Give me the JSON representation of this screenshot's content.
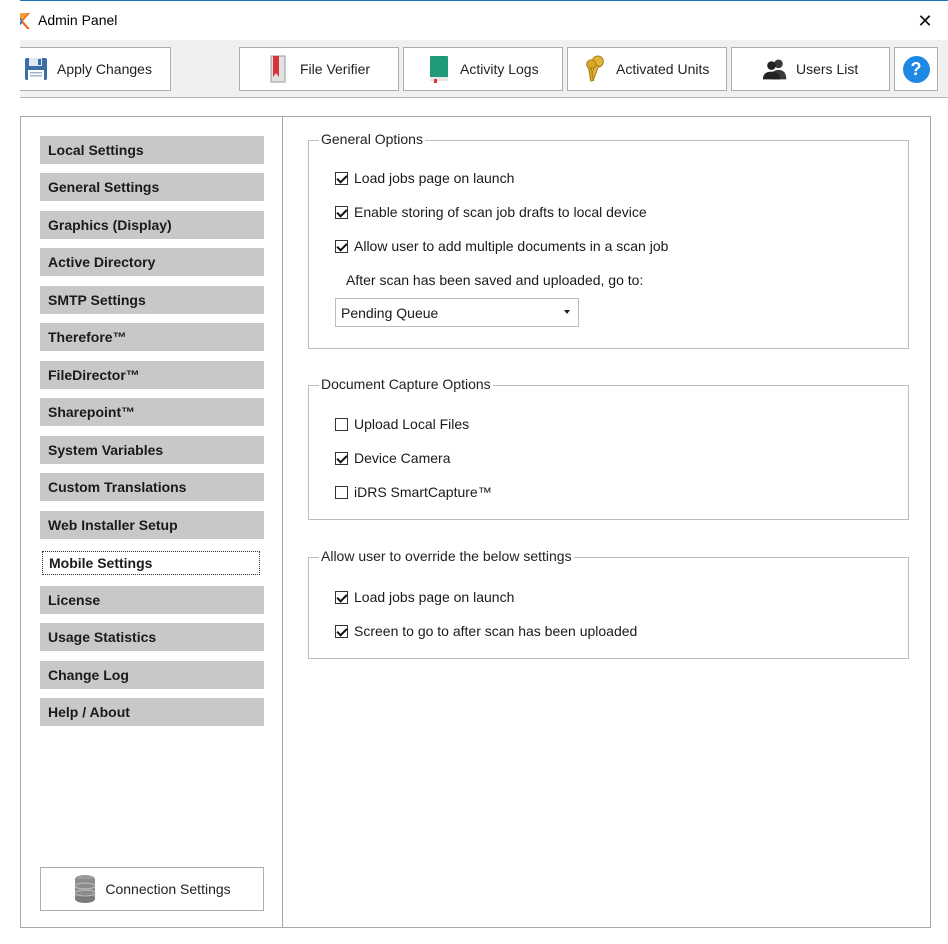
{
  "window": {
    "title": "Admin Panel"
  },
  "toolbar": {
    "apply_label": "Apply Changes",
    "file_verifier_label": "File Verifier",
    "activity_logs_label": "Activity Logs",
    "activated_units_label": "Activated Units",
    "users_list_label": "Users List",
    "help_glyph": "?"
  },
  "sidebar": {
    "items": [
      {
        "label": "Local Settings"
      },
      {
        "label": "General Settings"
      },
      {
        "label": "Graphics (Display)"
      },
      {
        "label": "Active Directory"
      },
      {
        "label": "SMTP Settings"
      },
      {
        "label": "Therefore™"
      },
      {
        "label": "FileDirector™"
      },
      {
        "label": "Sharepoint™"
      },
      {
        "label": "System Variables"
      },
      {
        "label": "Custom Translations"
      },
      {
        "label": "Web Installer Setup"
      },
      {
        "label": "Mobile Settings"
      },
      {
        "label": "License"
      },
      {
        "label": "Usage Statistics"
      },
      {
        "label": "Change Log"
      },
      {
        "label": "Help / About"
      }
    ],
    "active_label": "Mobile Settings",
    "connection_label": "Connection Settings"
  },
  "general_options": {
    "legend": "General Options",
    "options": [
      {
        "label": "Load jobs page on launch",
        "checked": true
      },
      {
        "label": "Enable storing of scan job drafts to local device",
        "checked": true
      },
      {
        "label": "Allow user to add multiple documents in a scan job",
        "checked": true
      }
    ],
    "after_scan_label": "After scan has been saved and uploaded, go to:",
    "after_scan_value": "Pending Queue"
  },
  "capture_options": {
    "legend": "Document Capture Options",
    "options": [
      {
        "label": "Upload Local Files",
        "checked": false
      },
      {
        "label": "Device Camera",
        "checked": true
      },
      {
        "label": "iDRS SmartCapture™",
        "checked": false
      }
    ]
  },
  "override_options": {
    "legend": "Allow user to override the below settings",
    "options": [
      {
        "label": "Load jobs page on launch",
        "checked": true
      },
      {
        "label": "Screen to go to after scan has been uploaded",
        "checked": true
      }
    ]
  },
  "colors": {
    "accent": "#1f6fb5",
    "nav_bg": "#c8c8c8",
    "help_blue": "#1e88e5"
  },
  "icons": {
    "app": "x-logo-icon",
    "apply": "floppy-disk-icon",
    "file_verifier": "bookmark-book-icon",
    "activity_logs": "green-book-icon",
    "activated_units": "keys-icon",
    "users_list": "users-icon",
    "help": "help-circle-icon",
    "connection": "database-icon"
  }
}
